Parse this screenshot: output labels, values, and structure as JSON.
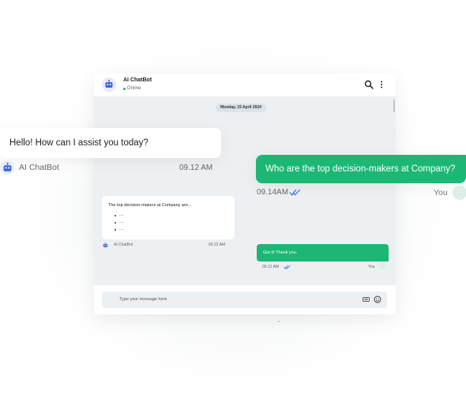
{
  "header": {
    "title": "AI ChatBot",
    "status": "Online"
  },
  "chat": {
    "date": "Monday, 15 April 2024",
    "incoming_small": {
      "text": "The top decision-makers at Company are...",
      "bullets": [
        "....",
        "....",
        "...."
      ],
      "sender": "AI ChatBot",
      "time": "09.22 AM"
    },
    "outgoing_small": {
      "text": "Got it! Thank you.",
      "time": "09.31 AM",
      "sender": "You"
    }
  },
  "input": {
    "placeholder": "Type your message here"
  },
  "overlay": {
    "incoming": {
      "text": "Hello! How can I assist you today?",
      "sender": "AI ChatBot",
      "time": "09.12 AM"
    },
    "outgoing": {
      "text": "Who are the top decision-makers at Company?",
      "time": "09.14AM",
      "sender": "You"
    }
  },
  "icons": {
    "bot": "robot-icon",
    "search": "search-icon",
    "menu": "more-vertical-icon",
    "read": "double-check-icon",
    "keyboard": "keyboard-icon",
    "emoji": "emoji-icon"
  },
  "colors": {
    "accent_green": "#1cb774",
    "bot_blue": "#3d63dd",
    "chat_bg": "#edf0f3"
  }
}
